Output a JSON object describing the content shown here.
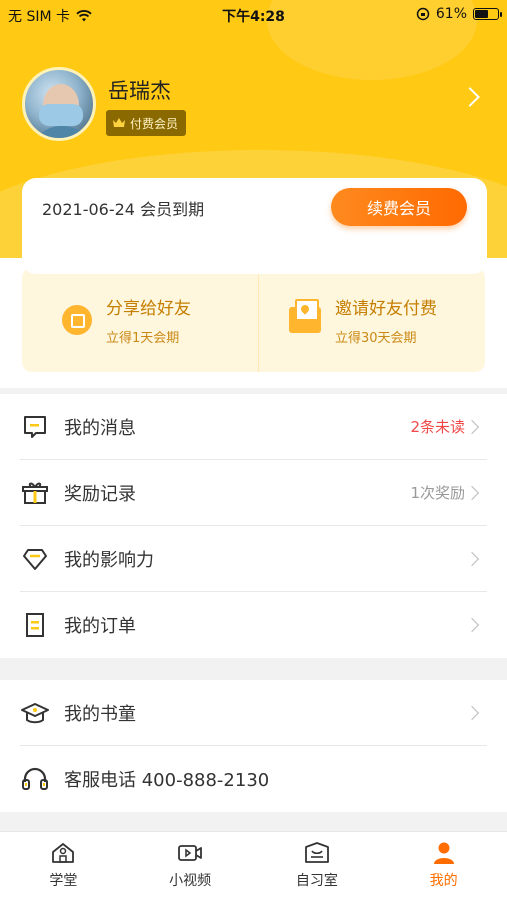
{
  "status_bar": {
    "carrier": "无 SIM 卡",
    "time": "下午4:28",
    "battery": "61%",
    "battery_level": 0.61
  },
  "profile": {
    "name": "岳瑞杰",
    "badge": "付费会员"
  },
  "membership": {
    "expire_text": "2021-06-24 会员到期",
    "renew_label": "续费会员"
  },
  "share": {
    "items": [
      {
        "title": "分享给好友",
        "subtitle": "立得1天会期",
        "icon": "share-icon"
      },
      {
        "title": "邀请好友付费",
        "subtitle": "立得30天会期",
        "icon": "envelope-heart-icon"
      }
    ]
  },
  "menu_group1": {
    "items": [
      {
        "label": "我的消息",
        "extra": "2条未读",
        "icon": "message-icon"
      },
      {
        "label": "奖励记录",
        "extra": "1次奖励",
        "icon": "gift-icon"
      },
      {
        "label": "我的影响力",
        "extra": "",
        "icon": "diamond-icon"
      },
      {
        "label": "我的订单",
        "extra": "",
        "icon": "order-icon"
      }
    ]
  },
  "menu_group2": {
    "items": [
      {
        "label": "我的书童",
        "icon": "graduation-cap-icon"
      },
      {
        "label": "客服电话 400-888-2130",
        "icon": "headset-icon"
      }
    ]
  },
  "tabbar": {
    "tabs": [
      {
        "label": "学堂",
        "icon": "school-icon",
        "active": false
      },
      {
        "label": "小视频",
        "icon": "video-icon",
        "active": false
      },
      {
        "label": "自习室",
        "icon": "study-room-icon",
        "active": false
      },
      {
        "label": "我的",
        "icon": "user-icon",
        "active": true
      }
    ]
  },
  "colors": {
    "brand_yellow": "#ffc914",
    "accent_orange": "#ff6d00",
    "unread_red": "#f04848"
  }
}
